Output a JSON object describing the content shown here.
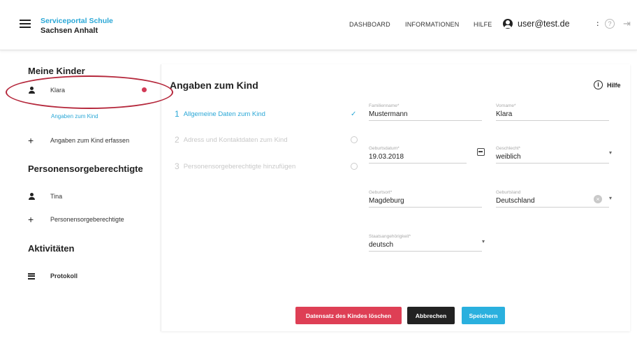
{
  "header": {
    "brand_line1": "Serviceportal Schule",
    "brand_line2": "Sachsen Anhalt",
    "nav": [
      "DASHBOARD",
      "INFORMATIONEN",
      "HILFE"
    ],
    "user": "user@test.de",
    "dot": ":",
    "help_glyph": "?",
    "logout_glyph": "⇥"
  },
  "sidebar": {
    "section_kinder": "Meine Kinder",
    "child_name": "Klara",
    "child_sub_link": "Angaben zum Kind",
    "add_child": "Angaben zum Kind erfassen",
    "section_sorge": "Personensorgeberechtigte",
    "guardian_name": "Tina",
    "add_guardian": "Personensorgeberechtigte",
    "section_akt": "Aktivitäten",
    "protocol": "Protokoll"
  },
  "main": {
    "title": "Angaben zum Kind",
    "help": "Hilfe",
    "steps": [
      {
        "num": "1",
        "label": "Allgemeine Daten zum Kind",
        "state": "active"
      },
      {
        "num": "2",
        "label": "Adress und Kontaktdaten zum Kind",
        "state": "inactive"
      },
      {
        "num": "3",
        "label": "Personensorgeberechtigte hinzufügen",
        "state": "inactive"
      }
    ],
    "fields": {
      "familienname": {
        "label": "Familienname*",
        "value": "Mustermann"
      },
      "vorname": {
        "label": "Vorname*",
        "value": "Klara"
      },
      "geburtsdatum": {
        "label": "Geburtsdatum*",
        "value": "19.03.2018"
      },
      "geschlecht": {
        "label": "Geschlecht*",
        "value": "weiblich"
      },
      "geburtsort": {
        "label": "Geburtsort*",
        "value": "Magdeburg"
      },
      "geburtsland": {
        "label": "Geburtsland",
        "value": "Deutschland"
      },
      "staatsangehoerigkeit": {
        "label": "Staatsangehörigkeit*",
        "value": "deutsch"
      }
    },
    "buttons": {
      "delete": "Datensatz des Kindes löschen",
      "cancel": "Abbrechen",
      "save": "Speichern"
    }
  },
  "colors": {
    "accent": "#2aa7d6",
    "danger": "#de3f55",
    "annotation": "#b5283c"
  },
  "icons": [
    "menu-icon",
    "account-icon",
    "help-icon",
    "logout-icon",
    "person-icon",
    "plus-icon",
    "list-icon",
    "info-icon",
    "check-icon",
    "calendar-icon",
    "clear-icon",
    "caret-down-icon"
  ]
}
